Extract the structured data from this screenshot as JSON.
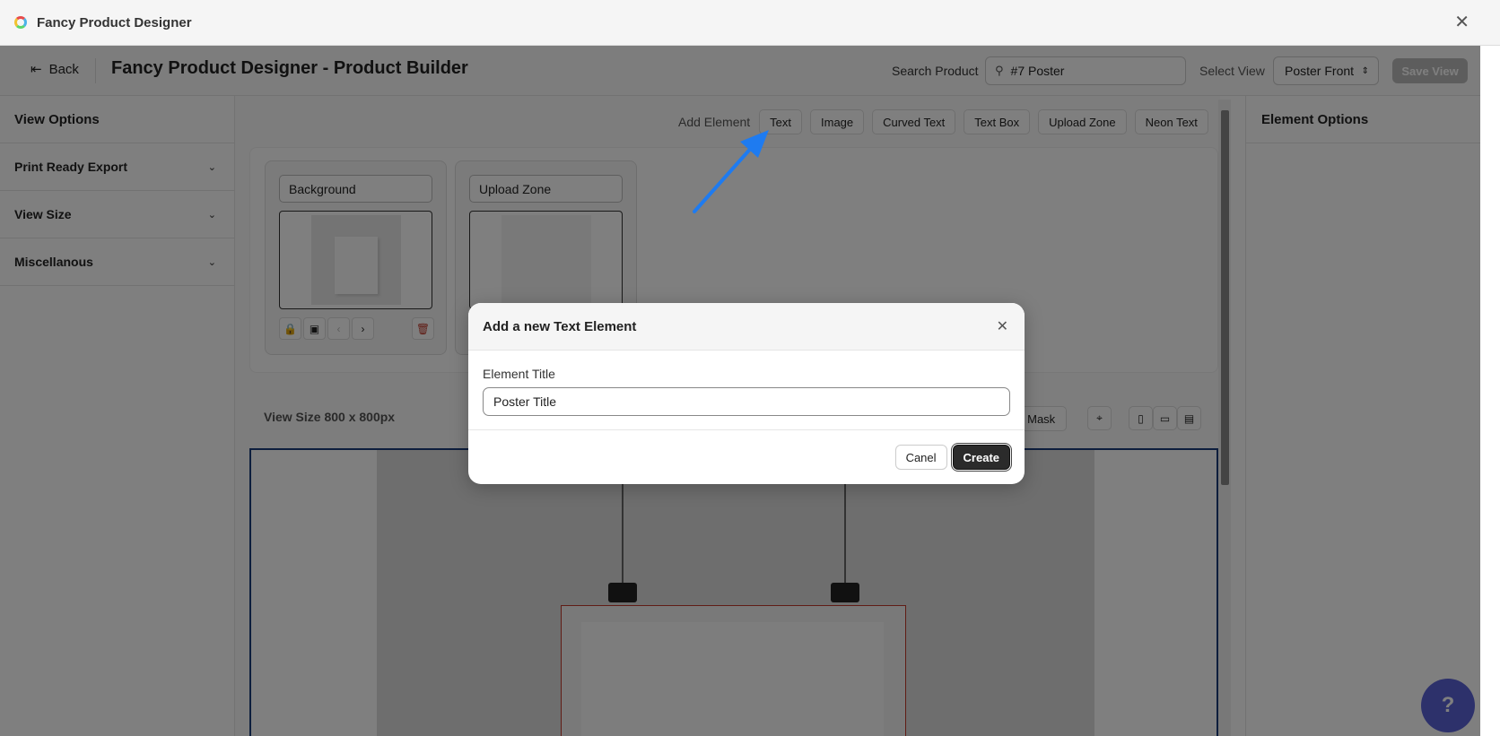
{
  "window": {
    "title": "Fancy Product Designer"
  },
  "header": {
    "back_label": "Back",
    "page_title": "Fancy Product Designer - Product Builder",
    "search_label": "Search Product",
    "search_value": "#7 Poster",
    "view_label": "Select View",
    "view_value": "Poster Front",
    "save_view_label": "Save View"
  },
  "left_sidebar": {
    "title": "View Options",
    "items": [
      {
        "label": "Print Ready Export"
      },
      {
        "label": "View Size"
      },
      {
        "label": "Miscellanous"
      }
    ]
  },
  "right_sidebar": {
    "title": "Element Options"
  },
  "toolbar": {
    "add_element_label": "Add Element",
    "buttons": [
      "Text",
      "Image",
      "Curved Text",
      "Text Box",
      "Upload Zone",
      "Neon Text"
    ]
  },
  "layers": [
    {
      "name": "Background"
    },
    {
      "name": "Upload Zone"
    }
  ],
  "stage": {
    "view_size_label": "View Size 800 x 800px",
    "mask_label": "s Mask"
  },
  "modal": {
    "title": "Add a new Text Element",
    "field_label": "Element Title",
    "field_value": "Poster Title",
    "cancel_label": "Canel",
    "create_label": "Create"
  },
  "colors": {
    "accent_arrow": "#1e7bf0",
    "help_bubble": "#5b63d6",
    "create_button": "#2b2b2b",
    "stage_border": "#1a3d7a"
  }
}
